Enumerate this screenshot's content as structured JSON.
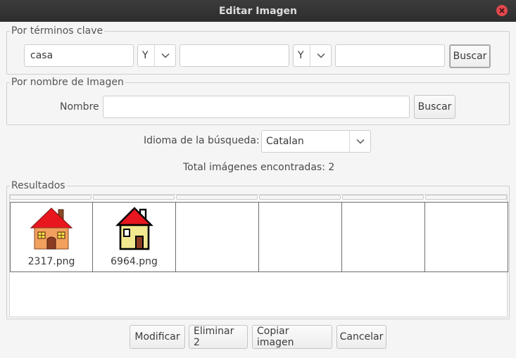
{
  "window": {
    "title": "Editar Imagen"
  },
  "keywords": {
    "legend": "Por términos clave",
    "field1_value": "casa",
    "op1": "Y",
    "field2_value": "",
    "op2": "Y",
    "field3_value": "",
    "search_label": "Buscar"
  },
  "by_name": {
    "legend": "Por nombre de Imagen",
    "name_label": "Nombre",
    "name_value": "",
    "search_label": "Buscar"
  },
  "language": {
    "label": "Idioma de la búsqueda:",
    "selected": "Catalan"
  },
  "total_found": "Total imágenes encontradas: 2",
  "results": {
    "legend": "Resultados",
    "items": [
      {
        "filename": "2317.png",
        "icon": "house-orange-icon"
      },
      {
        "filename": "6964.png",
        "icon": "house-yellow-icon"
      }
    ]
  },
  "actions": {
    "modify": "Modificar",
    "delete": "Eliminar 2",
    "copy": "Copiar imagen",
    "cancel": "Cancelar"
  },
  "colors": {
    "titlebar": "#2d2d2d",
    "close": "#e0484c",
    "roof_red": "#e8161e",
    "house_orange": "#f2a05e",
    "house_yellow": "#f2e890"
  }
}
